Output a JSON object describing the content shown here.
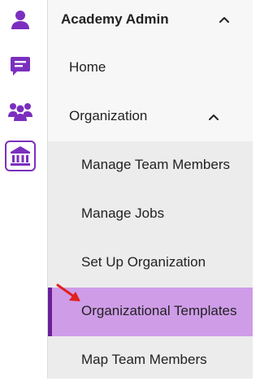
{
  "rail": {
    "items": [
      {
        "icon": "user-icon",
        "active": false
      },
      {
        "icon": "chat-icon",
        "active": false
      },
      {
        "icon": "team-icon",
        "active": false
      },
      {
        "icon": "institution-icon",
        "active": true
      }
    ]
  },
  "panel": {
    "title": "Academy Admin",
    "nav": {
      "home_label": "Home",
      "organization_label": "Organization"
    },
    "submenu": [
      {
        "label": "Manage Team Members"
      },
      {
        "label": "Manage Jobs"
      },
      {
        "label": "Set Up Organization"
      },
      {
        "label": "Organizational Templates"
      },
      {
        "label": "Map Team Members"
      }
    ]
  },
  "colors": {
    "accent": "#7b2fbe",
    "selected_bg": "#cf9ce8",
    "selected_indicator": "#6a1f9a",
    "annotation_arrow": "#e0211f"
  }
}
